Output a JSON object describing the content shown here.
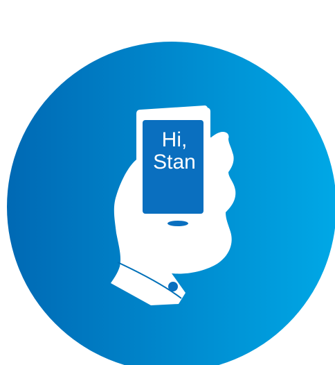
{
  "illustration": {
    "icon": "hand-holding-phone-icon",
    "phone_screen": {
      "line1": "Hi,",
      "line2": "Stan"
    },
    "colors": {
      "background": "#ffffff",
      "circle_gradient_start": "#0069b4",
      "circle_gradient_end": "#00a8e6",
      "hand": "#ffffff",
      "phone_screen": "#0a6fbf"
    }
  }
}
